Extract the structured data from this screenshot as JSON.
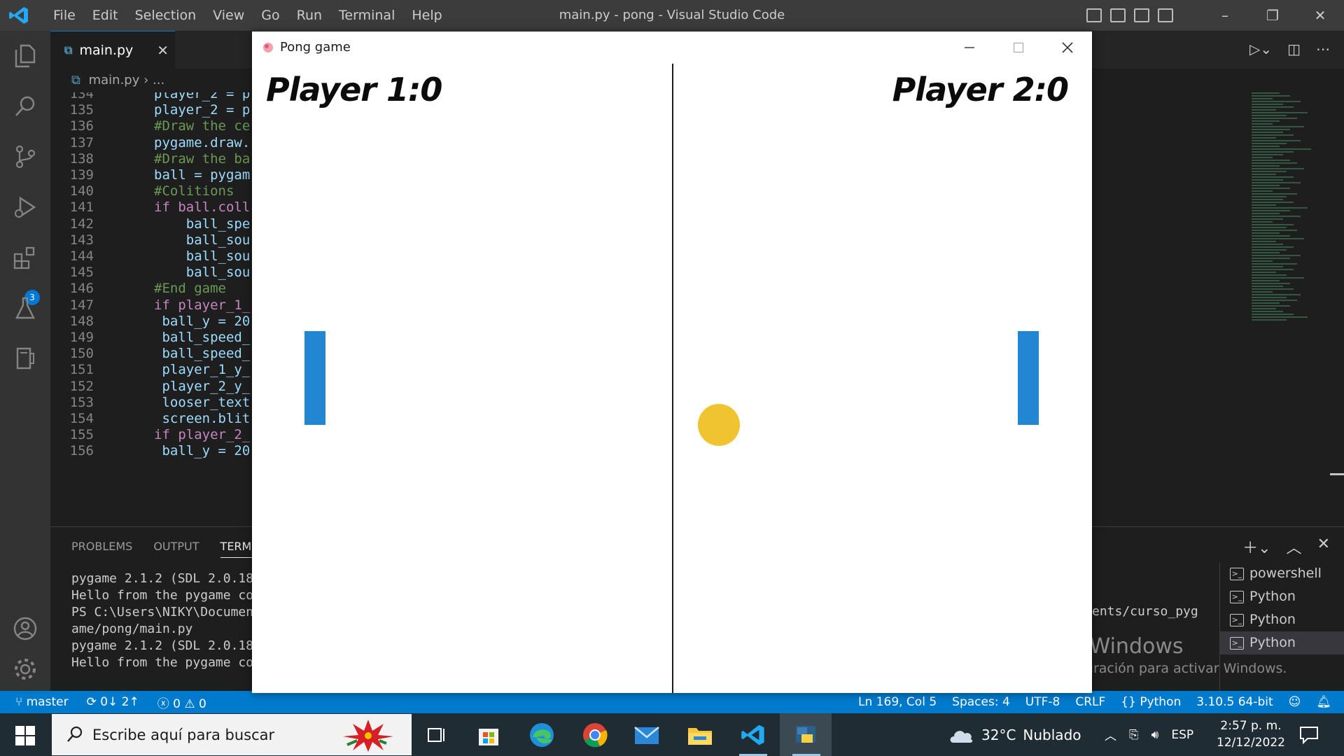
{
  "vscode": {
    "menu": [
      "File",
      "Edit",
      "Selection",
      "View",
      "Go",
      "Run",
      "Terminal",
      "Help"
    ],
    "window_title": "main.py - pong - Visual Studio Code",
    "tab": {
      "filename": "main.py"
    },
    "breadcrumb": {
      "file": "main.py",
      "rest": "..."
    },
    "code_lines": [
      {
        "n": "134",
        "text": "player_2 = p"
      },
      {
        "n": "135",
        "text": "player_2 = p"
      },
      {
        "n": "136",
        "text": "#Draw the ce"
      },
      {
        "n": "137",
        "text": "pygame.draw."
      },
      {
        "n": "138",
        "text": "#Draw the ba"
      },
      {
        "n": "139",
        "text": "ball = pygam"
      },
      {
        "n": "140",
        "text": "#Colitions"
      },
      {
        "n": "141",
        "text": "if ball.coll"
      },
      {
        "n": "142",
        "text": "    ball_spe"
      },
      {
        "n": "143",
        "text": "    ball_sou"
      },
      {
        "n": "144",
        "text": "    ball_sou"
      },
      {
        "n": "145",
        "text": "    ball_sou"
      },
      {
        "n": "146",
        "text": "#End game"
      },
      {
        "n": "147",
        "text": "if player_1_"
      },
      {
        "n": "148",
        "text": " ball_y = 20"
      },
      {
        "n": "149",
        "text": " ball_speed_"
      },
      {
        "n": "150",
        "text": " ball_speed_"
      },
      {
        "n": "151",
        "text": " player_1_y_"
      },
      {
        "n": "152",
        "text": " player_2_y_"
      },
      {
        "n": "153",
        "text": " looser_text"
      },
      {
        "n": "154",
        "text": " screen.blit"
      },
      {
        "n": "155",
        "text": "if player_2_"
      },
      {
        "n": "156",
        "text": " ball_y = 20"
      }
    ],
    "panel": {
      "tabs": [
        "PROBLEMS",
        "OUTPUT",
        "TERMINAL"
      ],
      "terminal_lines": [
        "pygame 2.1.2 (SDL 2.0.18",
        "Hello from the pygame co",
        "PS C:\\Users\\NIKY\\Documen",
        "ame/pong/main.py",
        "pygame 2.1.2 (SDL 2.0.18",
        "Hello from the pygame co"
      ],
      "terminal_right": "ents/curso_pyg",
      "terminals": [
        "powershell",
        "Python",
        "Python",
        "Python"
      ],
      "activate_title": "Activar Windows",
      "activate_sub": "Ve a Configuración para activar Windows."
    },
    "status": {
      "branch": "master",
      "sync": "0↓ 2↑",
      "errors": "0",
      "warnings": "0",
      "position": "Ln 169, Col 5",
      "spaces": "Spaces: 4",
      "encoding": "UTF-8",
      "eol": "CRLF",
      "language": "Python",
      "interpreter": "3.10.5 64-bit"
    },
    "extensions_badge": "3"
  },
  "pong": {
    "title": "Pong game",
    "score_left": "Player 1:0",
    "score_right": "Player 2:0",
    "colors": {
      "paddle": "#2286d3",
      "ball": "#f0c330",
      "background": "#ffffff",
      "line": "#1a1a1a"
    }
  },
  "taskbar": {
    "search_placeholder": "Escribe aquí para buscar",
    "temperature": "32°C",
    "weather": "Nublado",
    "language": "ESP",
    "time": "2:57 p. m.",
    "date": "12/12/2022"
  }
}
